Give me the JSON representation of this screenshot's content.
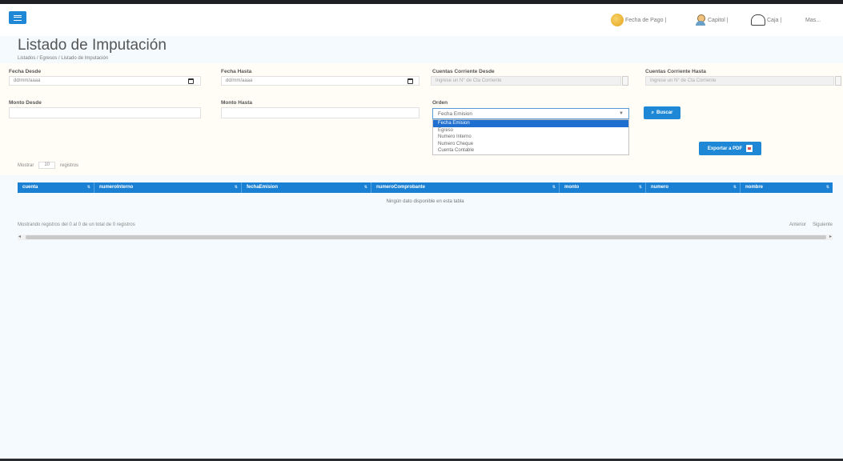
{
  "header": {
    "fecha_pago": "Fecha de Pago |",
    "usuario": "Capitol |",
    "caja": "Caja |",
    "mas": "Mas..."
  },
  "page": {
    "title": "Listado de Imputación",
    "breadcrumb": "Listados / Egresos / Listado de Imputación"
  },
  "filters": {
    "fecha_desde_label": "Fecha Desde",
    "fecha_desde_value": "dd/mm/aaaa",
    "fecha_hasta_label": "Fecha Hasta",
    "fecha_hasta_value": "dd/mm/aaaa",
    "cc_desde_label": "Cuentas Corriente Desde",
    "cc_desde_placeholder": "Ingrese un N° de Cta Corriente",
    "cc_hasta_label": "Cuentas Corriente Hasta",
    "cc_hasta_placeholder": "Ingrese un N° de Cta Corriente",
    "monto_desde_label": "Monto Desde",
    "monto_hasta_label": "Monto Hasta",
    "orden_label": "Orden",
    "orden_selected": "Fecha Emision",
    "orden_options": [
      "Fecha Emision",
      "Egreso",
      "Numero Interno",
      "Numero Cheque",
      "Cuenta Contable"
    ],
    "buscar_label": "Buscar"
  },
  "table": {
    "export_label": "Exportar a PDF",
    "show_prefix": "Mostrar",
    "show_value": "10",
    "show_suffix": "registros",
    "columns": [
      "cuenta",
      "numeroInterno",
      "fechaEmision",
      "numeroComprobante",
      "monto",
      "numero",
      "nombre"
    ],
    "empty_message": "Ningún dato disponible en esta tabla",
    "info": "Mostrando registros del 0 al 0 de un total de 0 registros",
    "prev_label": "Anterior",
    "next_label": "Siguiente"
  }
}
